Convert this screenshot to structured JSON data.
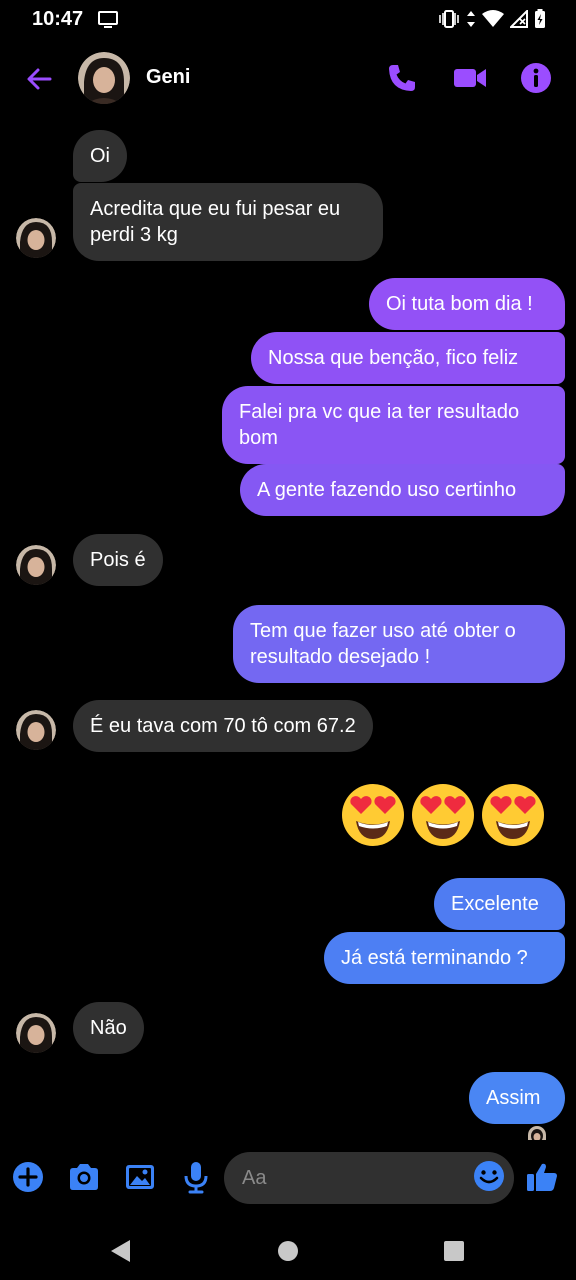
{
  "status_bar": {
    "time": "10:47"
  },
  "header": {
    "contact_name": "Geni"
  },
  "colors": {
    "accent": "#9b4dff",
    "incoming_bubble": "#303030",
    "outgoing_purple": "#8a4cf8",
    "outgoing_blue": "#4f7cf2",
    "like_blue": "#3b82f6"
  },
  "messages": [
    {
      "dir": "in",
      "text": "Oi"
    },
    {
      "dir": "in",
      "text": "Acredita que eu fui pesar eu perdi 3 kg"
    },
    {
      "dir": "out",
      "text": "Oi tuta bom dia !"
    },
    {
      "dir": "out",
      "text": "Nossa que benção, fico feliz"
    },
    {
      "dir": "out",
      "text": "Falei pra vc que ia ter resultado bom"
    },
    {
      "dir": "out",
      "text": "A gente fazendo uso certinho"
    },
    {
      "dir": "in",
      "text": "Pois é"
    },
    {
      "dir": "out",
      "text": "Tem que fazer uso até obter o resultado desejado !"
    },
    {
      "dir": "in",
      "text": "É eu tava com 70 tô com 67.2"
    },
    {
      "dir": "out",
      "text": "😍😍😍"
    },
    {
      "dir": "out",
      "text": "Excelente"
    },
    {
      "dir": "out",
      "text": "Já está terminando ?"
    },
    {
      "dir": "in",
      "text": "Não"
    },
    {
      "dir": "out",
      "text": "Assim"
    }
  ],
  "composer": {
    "placeholder": "Aa"
  },
  "icons": {
    "header": [
      "back-arrow-icon",
      "phone-icon",
      "video-camera-icon",
      "info-icon"
    ],
    "composer": [
      "plus-icon",
      "camera-icon",
      "image-icon",
      "microphone-icon",
      "emoji-icon",
      "thumbs-up-icon"
    ],
    "navbar": [
      "back-triangle-icon",
      "home-circle-icon",
      "recents-square-icon"
    ]
  }
}
